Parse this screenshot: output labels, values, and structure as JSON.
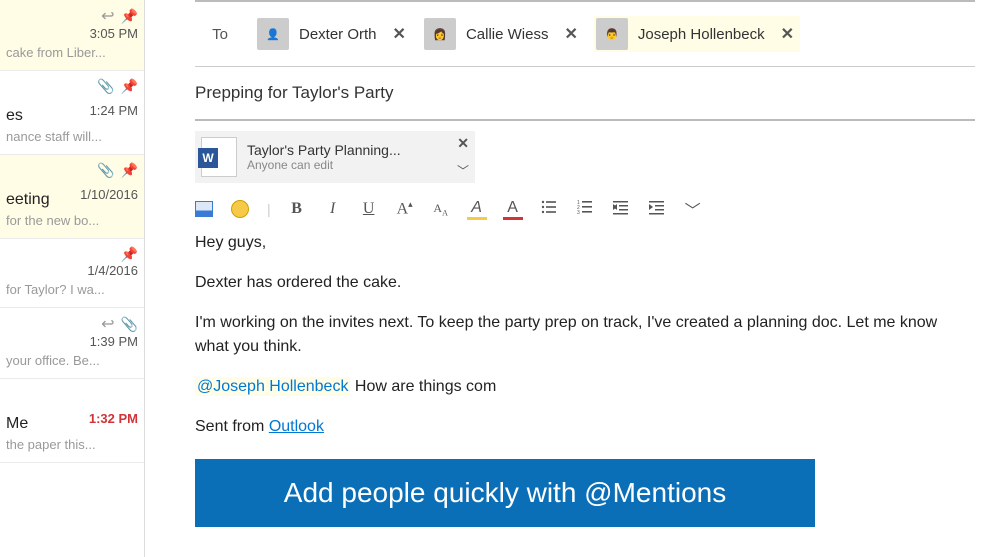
{
  "sidebar": {
    "items": [
      {
        "title": "",
        "preview": "cake from Liber...",
        "time": "3:05 PM",
        "highlight": true,
        "icons": [
          "reply",
          "pin"
        ]
      },
      {
        "title": "es",
        "preview": "nance staff will...",
        "time": "1:24 PM",
        "highlight": false,
        "icons": [
          "clip",
          "pin"
        ]
      },
      {
        "title": "eeting",
        "preview": "for the new bo...",
        "time": "1/10/2016",
        "highlight": true,
        "icons": [
          "clip",
          "pin"
        ]
      },
      {
        "title": "",
        "preview": "for Taylor? I wa...",
        "time": "1/4/2016",
        "highlight": false,
        "icons": [
          "pin"
        ]
      },
      {
        "title": "",
        "preview": "your office. Be...",
        "time": "1:39 PM",
        "highlight": false,
        "icons": [
          "reply",
          "clip"
        ]
      },
      {
        "title": "Me",
        "preview": "the paper this...",
        "time": "1:32 PM",
        "highlight": false,
        "time_red": true,
        "icons": []
      }
    ]
  },
  "compose": {
    "to_label": "To",
    "recipients": [
      {
        "name": "Dexter Orth",
        "highlight": false
      },
      {
        "name": "Callie Wiess",
        "highlight": false
      },
      {
        "name": "Joseph Hollenbeck",
        "highlight": true
      }
    ],
    "subject": "Prepping for Taylor's Party",
    "attachment": {
      "name": "Taylor's Party Planning...",
      "sub": "Anyone can edit"
    },
    "body": {
      "p1": "Hey guys,",
      "p2": "Dexter has ordered the cake.",
      "p3": "I'm working on the invites next. To keep the party prep on track, I've created a planning doc. Let me know what you think.",
      "mention": "@Joseph Hollenbeck",
      "p4_rest": " How are things com",
      "sig_pre": "Sent from ",
      "sig_link": "Outlook"
    },
    "banner": "Add people quickly with @Mentions"
  },
  "toolbar": {
    "buttons": [
      "image",
      "emoji",
      "sep",
      "bold",
      "italic",
      "underline",
      "font-grow",
      "font-shrink",
      "highlight",
      "font-color",
      "bullets",
      "numbering",
      "indent-left",
      "indent-right",
      "more"
    ]
  }
}
